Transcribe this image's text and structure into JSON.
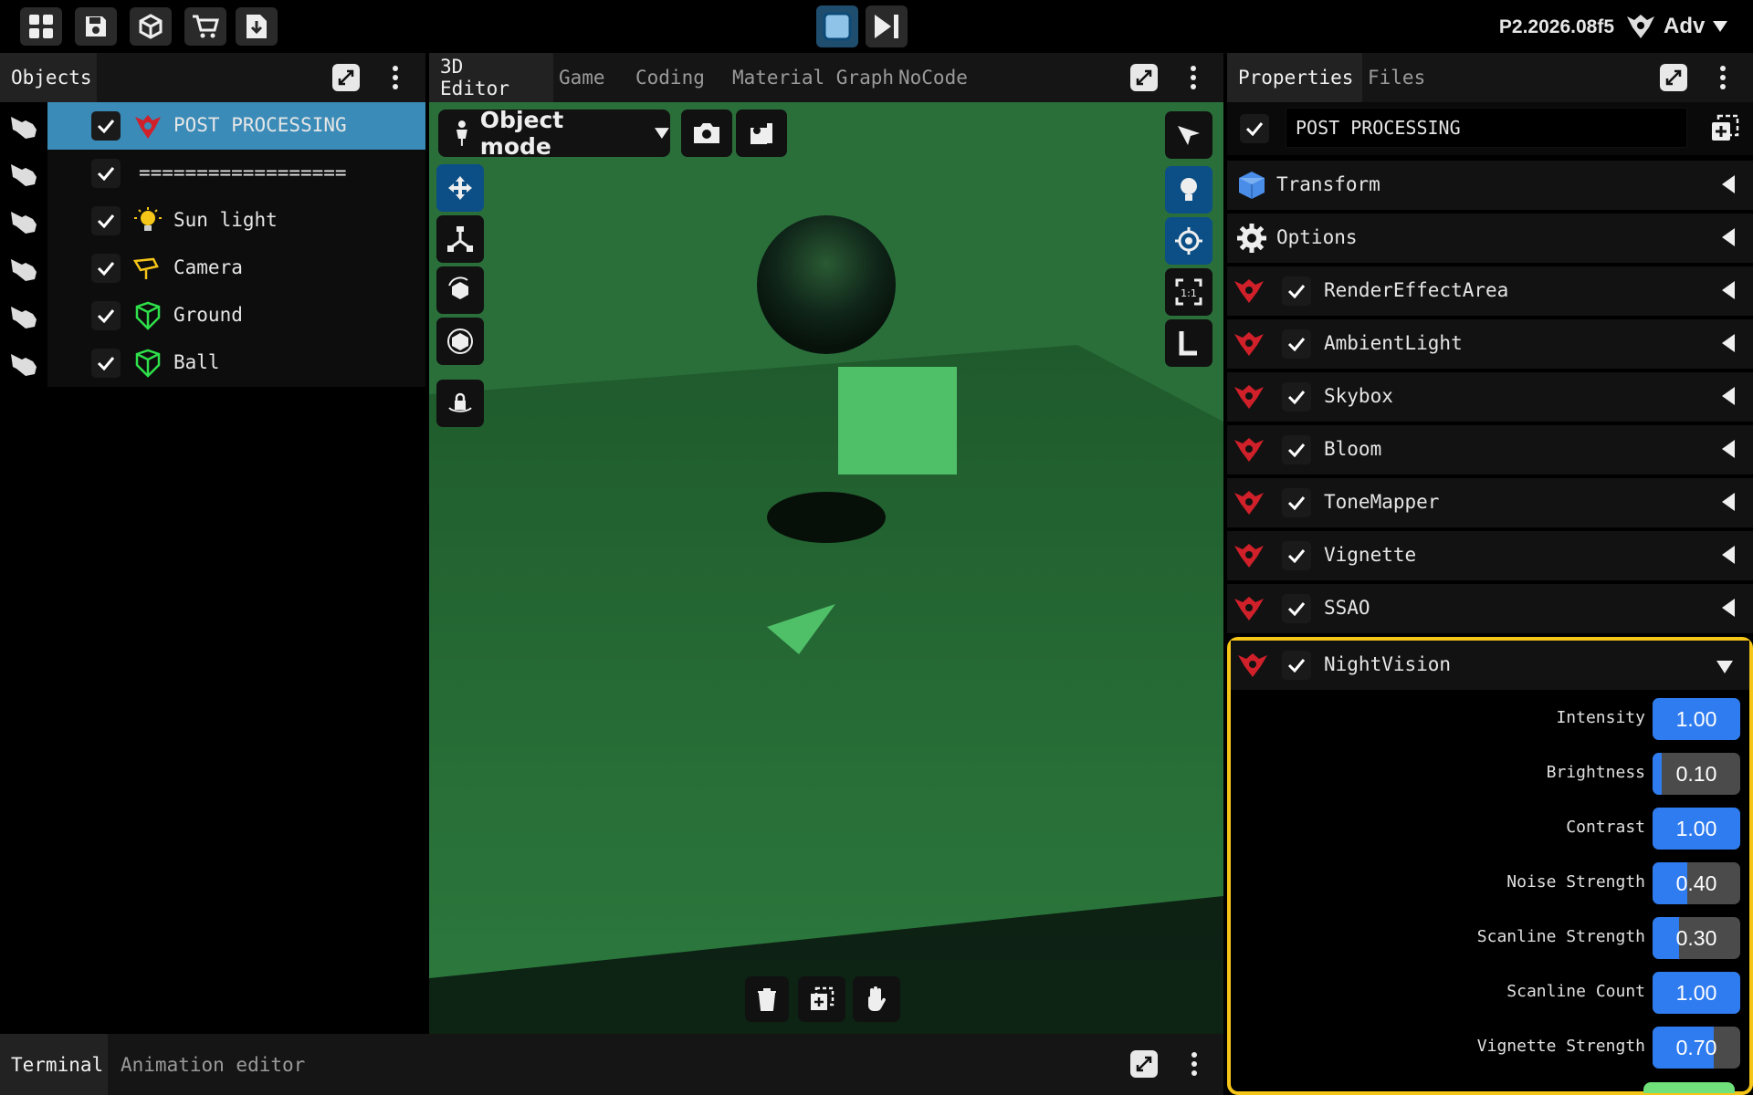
{
  "toolbar": {
    "buttons": [
      "grid-icon",
      "save-icon",
      "cube-icon",
      "cart-icon",
      "download-icon"
    ],
    "play_controls": [
      "stop-icon",
      "step-icon"
    ],
    "version": "P2.2026.08f5",
    "mode": "Adv"
  },
  "objects_panel": {
    "title": "Objects",
    "items": [
      {
        "label": "POST PROCESSING",
        "icon": "post-processing-icon",
        "selected": true
      },
      {
        "label": "==================",
        "icon": "",
        "selected": false
      },
      {
        "label": "Sun light",
        "icon": "bulb-icon",
        "selected": false
      },
      {
        "label": "Camera",
        "icon": "camera-icon",
        "selected": false
      },
      {
        "label": "Ground",
        "icon": "mesh-icon",
        "selected": false
      },
      {
        "label": "Ball",
        "icon": "mesh-icon",
        "selected": false
      }
    ]
  },
  "editor_panel": {
    "tabs": [
      "3D Editor",
      "Game",
      "Coding",
      "Material Graph",
      "NoCode"
    ],
    "active_tab": "3D Editor",
    "mode_label": "Object mode"
  },
  "properties_panel": {
    "tabs": [
      "Properties",
      "Files"
    ],
    "active_tab": "Properties",
    "object_name": "POST PROCESSING",
    "sections": [
      {
        "label": "Transform",
        "icon": "cube-icon"
      },
      {
        "label": "Options",
        "icon": "gear-icon"
      }
    ],
    "effects": [
      {
        "label": "RenderEffectArea"
      },
      {
        "label": "AmbientLight"
      },
      {
        "label": "Skybox"
      },
      {
        "label": "Bloom"
      },
      {
        "label": "ToneMapper"
      },
      {
        "label": "Vignette"
      },
      {
        "label": "SSAO"
      },
      {
        "label": "NightVision",
        "expanded": true
      }
    ],
    "nightvision_params": [
      {
        "label": "Intensity",
        "value": "1.00",
        "fraction": 1.0
      },
      {
        "label": "Brightness",
        "value": "0.10",
        "fraction": 0.1
      },
      {
        "label": "Contrast",
        "value": "1.00",
        "fraction": 1.0
      },
      {
        "label": "Noise Strength",
        "value": "0.40",
        "fraction": 0.4
      },
      {
        "label": "Scanline Strength",
        "value": "0.30",
        "fraction": 0.3
      },
      {
        "label": "Scanline Count",
        "value": "1.00",
        "fraction": 1.0
      },
      {
        "label": "Vignette Strength",
        "value": "0.70",
        "fraction": 0.7
      }
    ]
  },
  "bottom_panel": {
    "tabs": [
      "Terminal",
      "Animation editor"
    ],
    "active_tab": "Terminal"
  },
  "colors": {
    "accent_blue": "#2f7cf0",
    "selection": "#3a8bb8",
    "highlight": "#f5c518",
    "nightvision_green": "#2f7a40",
    "effect_red": "#d0202a"
  }
}
